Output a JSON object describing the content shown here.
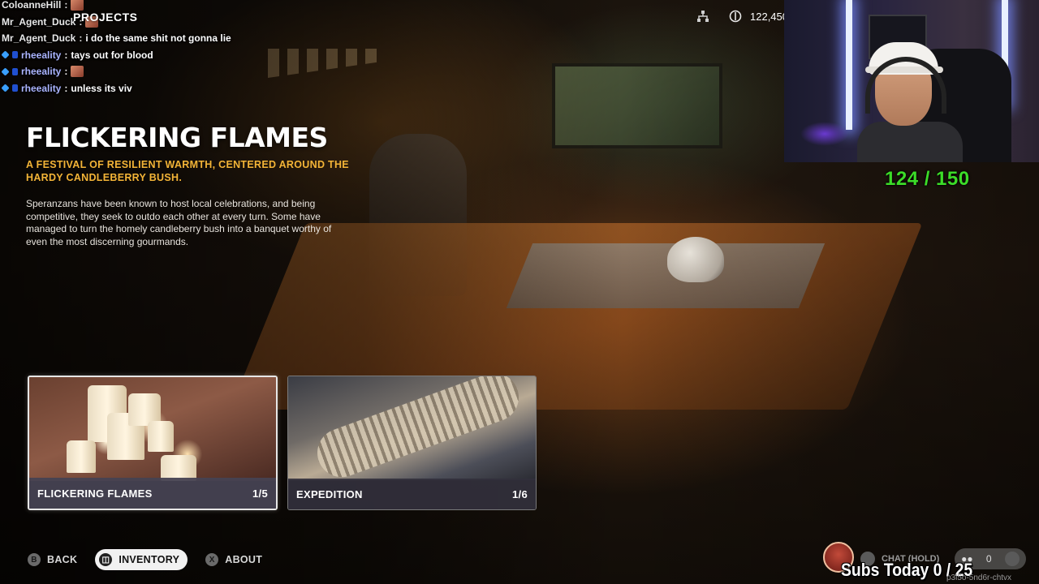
{
  "chat": [
    {
      "user": "ColoanneHill",
      "message": "",
      "emote": true,
      "badges": 0,
      "color": "white"
    },
    {
      "user": "Mr_Agent_Duck",
      "message": "",
      "emote": true,
      "badges": 0,
      "color": "white"
    },
    {
      "user": "Mr_Agent_Duck",
      "message": "i do the same shit not gonna lie",
      "emote": false,
      "badges": 0,
      "color": "white"
    },
    {
      "user": "rheeality",
      "message": "tays out for blood",
      "emote": false,
      "badges": 2,
      "color": "blue"
    },
    {
      "user": "rheeality",
      "message": "",
      "emote": true,
      "badges": 2,
      "color": "blue"
    },
    {
      "user": "rheeality",
      "message": "unless its viv",
      "emote": false,
      "badges": 2,
      "color": "blue"
    }
  ],
  "header": {
    "section_label": "PROJECTS",
    "currency_value": "122,450",
    "icons": [
      "network-icon",
      "currency-icon"
    ]
  },
  "project": {
    "title": "FLICKERING FLAMES",
    "subtitle": "A FESTIVAL OF RESILIENT WARMTH, CENTERED AROUND THE HARDY CANDLEBERRY BUSH.",
    "description": "Speranzans have been known to host local celebrations, and being competitive, they seek to outdo each other at every turn. Some have managed to turn the homely candleberry bush into a banquet worthy of even the most discerning gourmands."
  },
  "cards": [
    {
      "name": "FLICKERING FLAMES",
      "progress": "1/5",
      "selected": true
    },
    {
      "name": "EXPEDITION",
      "progress": "1/6",
      "selected": false
    }
  ],
  "bottom_nav": [
    {
      "glyph": "B",
      "label": "BACK",
      "active": false
    },
    {
      "glyph": "◫",
      "label": "INVENTORY",
      "active": true
    },
    {
      "glyph": "X",
      "label": "ABOUT",
      "active": false
    }
  ],
  "overlay": {
    "counter": "124 / 150",
    "counter_color": "#3cdc28",
    "chat_hold_label": "CHAT (HOLD)",
    "friends_count": "0",
    "subs_label": "Subs Today  0 / 25",
    "session_code": "p3l5o-5nd6r-chtvx"
  },
  "colors": {
    "accent_subtitle": "#f3b437",
    "card_selected_border": "#e6e6e6"
  }
}
